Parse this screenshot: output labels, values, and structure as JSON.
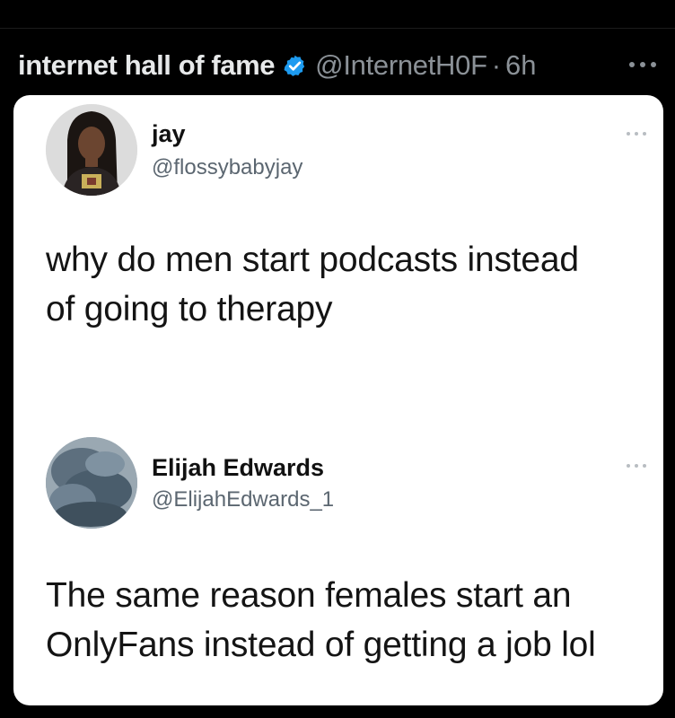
{
  "post": {
    "author_name": "internet hall of fame",
    "verified_icon": "verified-badge-icon",
    "handle": "@InternetH0F",
    "separator": "·",
    "time": "6h",
    "more_icon": "more-icon"
  },
  "screenshot": {
    "tweet1": {
      "name": "jay",
      "handle": "@flossybabyjay",
      "line1": "why do men start podcasts instead",
      "line2": "of going to therapy"
    },
    "tweet2": {
      "name": "Elijah Edwards",
      "handle": "@ElijahEdwards_1",
      "line1": "The same reason females start an",
      "line2": "OnlyFans instead of getting a job lol"
    }
  },
  "colors": {
    "background": "#000000",
    "verified": "#1d9bf0",
    "card": "#ffffff"
  }
}
